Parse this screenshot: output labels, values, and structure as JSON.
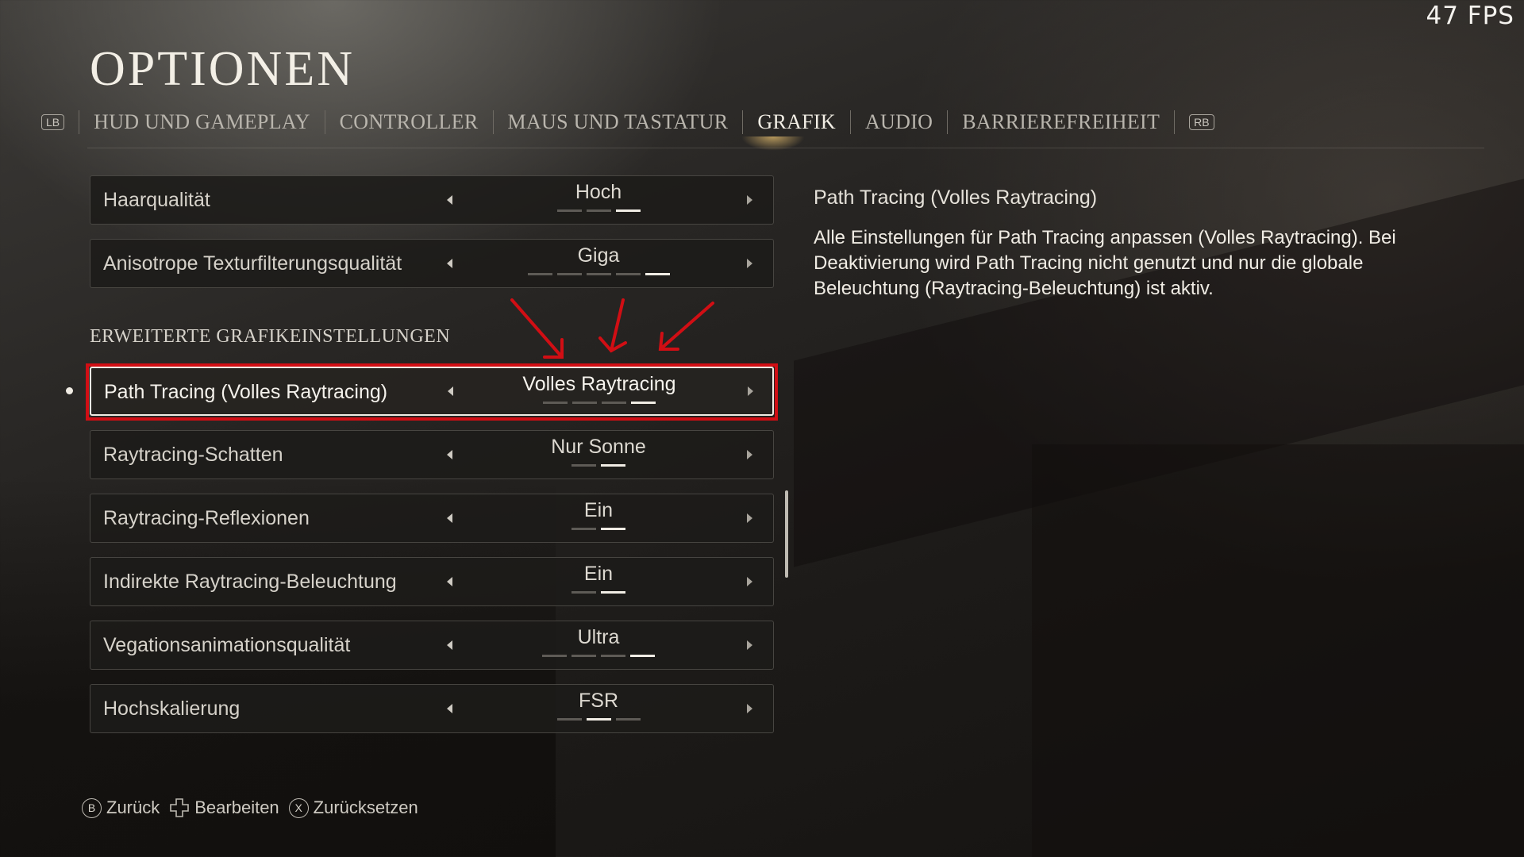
{
  "hud": {
    "fps": "47 FPS"
  },
  "header": {
    "title": "OPTIONEN",
    "bumper_left": "LB",
    "bumper_right": "RB",
    "tabs": [
      {
        "label": "HUD UND GAMEPLAY",
        "active": false
      },
      {
        "label": "CONTROLLER",
        "active": false
      },
      {
        "label": "MAUS UND TASTATUR",
        "active": false
      },
      {
        "label": "GRAFIK",
        "active": true
      },
      {
        "label": "AUDIO",
        "active": false
      },
      {
        "label": "BARRIEREFREIHEIT",
        "active": false
      }
    ]
  },
  "settings": {
    "basic": [
      {
        "label": "Haarqualität",
        "value": "Hoch",
        "level": 3,
        "levels": 3
      },
      {
        "label": "Anisotrope Texturfilterungsqualität",
        "value": "Giga",
        "level": 5,
        "levels": 5
      }
    ],
    "section_heading": "ERWEITERTE GRAFIKEINSTELLUNGEN",
    "advanced": [
      {
        "label": "Path Tracing (Volles Raytracing)",
        "value": "Volles Raytracing",
        "level": 4,
        "levels": 4,
        "selected": true
      },
      {
        "label": "Raytracing-Schatten",
        "value": "Nur Sonne",
        "level": 2,
        "levels": 2
      },
      {
        "label": "Raytracing-Reflexionen",
        "value": "Ein",
        "level": 2,
        "levels": 2
      },
      {
        "label": "Indirekte Raytracing-Beleuchtung",
        "value": "Ein",
        "level": 2,
        "levels": 2
      },
      {
        "label": "Vegationsanimationsqualität",
        "value": "Ultra",
        "level": 4,
        "levels": 4
      },
      {
        "label": "Hochskalierung",
        "value": "FSR",
        "level": 2,
        "levels": 3
      }
    ]
  },
  "description": {
    "title": "Path Tracing (Volles Raytracing)",
    "body": "Alle Einstellungen für Path Tracing anpassen (Volles Raytracing). Bei Deaktivierung wird Path Tracing nicht genutzt und nur die globale Beleuchtung (Raytracing-Beleuchtung) ist aktiv."
  },
  "footer": {
    "back": {
      "glyph": "B",
      "label": "Zurück"
    },
    "edit": {
      "glyph": "dpad-icon",
      "label": "Bearbeiten"
    },
    "reset": {
      "glyph": "X",
      "label": "Zurücksetzen"
    }
  },
  "colors": {
    "highlight_annotation": "#d10e14",
    "active_segment": "#f0ece4",
    "inactive_segment": "#5e5b56",
    "tab_glow": "#e6be6e"
  }
}
